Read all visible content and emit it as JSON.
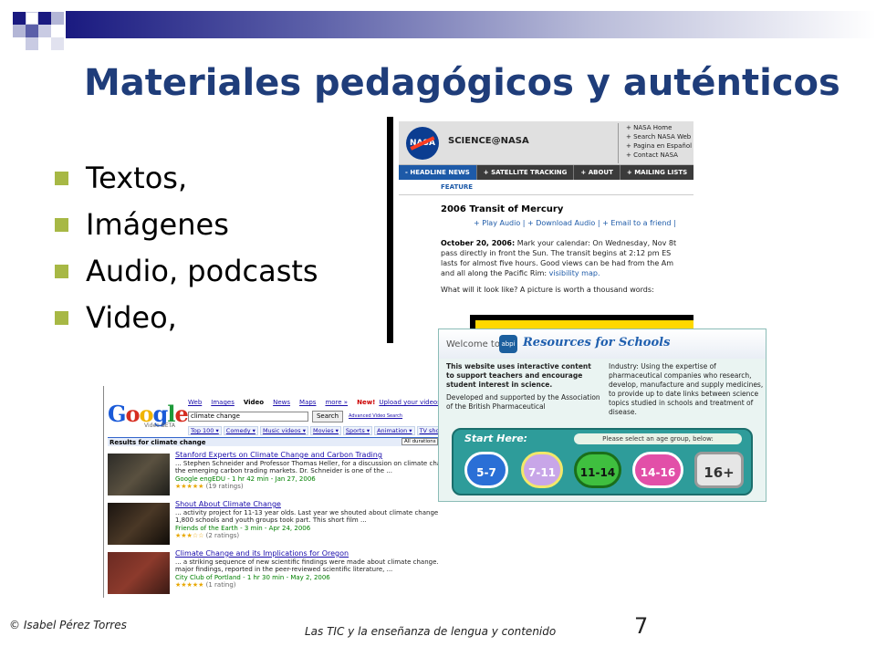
{
  "slide": {
    "title": "Materiales pedagógicos y auténticos",
    "bullets": [
      "Textos,",
      "Imágenes",
      "Audio, podcasts",
      "Video,"
    ],
    "footer_author": "© Isabel Pérez Torres",
    "footer_course": "Las TIC y la enseñanza de lengua y contenido",
    "page_number": "7"
  },
  "colors": {
    "title": "#1f3d7a",
    "bullet": "#a7b845",
    "band_dark": "#1a1a80"
  },
  "nasa": {
    "logo": "NASA",
    "brand": "SCIENCE@NASA",
    "links": [
      "+ NASA Home",
      "+ Search NASA Web",
      "+ Pagina en Español",
      "+ Contact NASA"
    ],
    "nav": [
      "- HEADLINE NEWS",
      "+ SATELLITE TRACKING",
      "+ ABOUT",
      "+ MAILING LISTS",
      "+ S"
    ],
    "feature": "FEATURE",
    "headline": "2006 Transit of Mercury",
    "audio_links": "+ Play Audio | + Download Audio | + Email to a friend |",
    "date": "October 20, 2006:",
    "body_1": " Mark your calendar: On Wednesday, Nov 8t",
    "body_2": "pass directly in front the Sun. The transit begins at 2:12 pm ES",
    "body_3": "lasts for almost five hours. Good views can be had from the Am",
    "body_4": "and all along the Pacific Rim: ",
    "body_link": "visibility map.",
    "question": "What will it look like? A picture is worth a thousand words:"
  },
  "abpi": {
    "welcome": "Welcome to",
    "badge": "abpi",
    "resources": "Resources for Schools",
    "left_bold": "This website uses interactive content to support teachers and encourage student interest in science.",
    "left_plain": "Developed and supported by the Association of the British Pharmaceutical",
    "right": "Industry: Using the expertise of pharmaceutical companies who research, develop, manufacture and supply medicines, to provide up to date links between science topics studied in schools and treatment of disease.",
    "start_here": "Start Here:",
    "select_prompt": "Please select an age group, below:",
    "ages": [
      "5-7",
      "7-11",
      "11-14",
      "14-16",
      "16+"
    ]
  },
  "google": {
    "logo_letters": [
      "G",
      "o",
      "o",
      "g",
      "l",
      "e"
    ],
    "logo_colors": [
      "#1a5ad8",
      "#d62d20",
      "#f0b400",
      "#1a5ad8",
      "#1e9a3a",
      "#d62d20"
    ],
    "logo_sub": "Video BETA",
    "tabs": [
      "Web",
      "Images",
      "Video",
      "News",
      "Maps",
      "more »"
    ],
    "new_label": "New!",
    "upload_link": "Upload your videos",
    "query": "climate change",
    "search_button": "Search",
    "advanced_link": "Advanced Video Search",
    "categories": [
      "Top 100 ▾",
      "Comedy ▾",
      "Music videos ▾",
      "Movies ▾",
      "Sports ▾",
      "Animation ▾",
      "TV shows"
    ],
    "results_header": "Results for climate change",
    "duration_filter": "All durations",
    "results": [
      {
        "title": "Stanford Experts on Climate Change and Carbon Trading",
        "snippet_1": "... Stephen Schneider and Professor Thomas Heller, for a discussion on climate change",
        "snippet_2": "the emerging carbon trading markets. Dr. Schneider is one of the ...",
        "source": "Google engEDU - 1 hr 42 min - Jan 27, 2006",
        "stars": "★★★★★",
        "ratings": "(19 ratings)"
      },
      {
        "title": "Shout About Climate Change",
        "snippet_1": "... activity project for 11-13 year olds. Last year we shouted about climate change and over",
        "snippet_2": "1,800 schools and youth groups took part. This short film ...",
        "source": "Friends of the Earth - 3 min - Apr 24, 2006",
        "stars": "★★★☆☆",
        "ratings": "(2 ratings)"
      },
      {
        "title": "Climate Change and its Implications for Oregon",
        "snippet_1": "... a striking sequence of new scientific findings were made about climate change. These",
        "snippet_2": "major findings, reported in the peer-reviewed scientific literature, ...",
        "source": "City Club of Portland - 1 hr 30 min - May 2, 2006",
        "stars": "★★★★★",
        "ratings": "(1 rating)"
      }
    ]
  }
}
